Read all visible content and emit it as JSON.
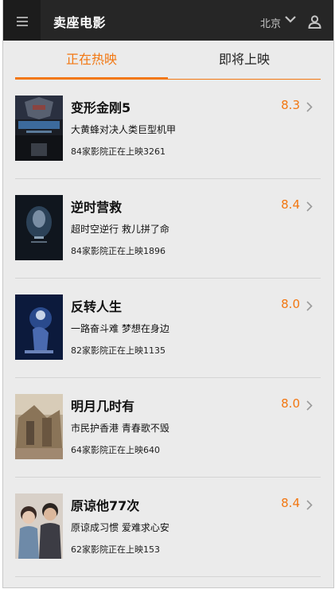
{
  "header": {
    "title": "卖座电影",
    "city": "北京",
    "menu_icon": "hamburger-icon",
    "user_icon": "user-icon"
  },
  "tabs": [
    {
      "label": "正在热映",
      "active": true
    },
    {
      "label": "即将上映",
      "active": false
    }
  ],
  "colors": {
    "accent": "#f27712",
    "topbar": "#262626",
    "background": "#ebebeb"
  },
  "movies": [
    {
      "title": "变形金刚5",
      "desc": "大黄蜂对决人类巨型机甲",
      "cinemas": "84家影院正在上映3261",
      "score": "8.3"
    },
    {
      "title": "逆时营救",
      "desc": "超时空逆行 救儿拼了命",
      "cinemas": "84家影院正在上映1896",
      "score": "8.4"
    },
    {
      "title": "反转人生",
      "desc": "一路奋斗难 梦想在身边",
      "cinemas": "82家影院正在上映1135",
      "score": "8.0"
    },
    {
      "title": "明月几时有",
      "desc": "市民护香港 青春歌不毁",
      "cinemas": "64家影院正在上映640",
      "score": "8.0"
    },
    {
      "title": "原谅他77次",
      "desc": "原谅成习惯 爱难求心安",
      "cinemas": "62家影院正在上映153",
      "score": "8.4"
    }
  ]
}
